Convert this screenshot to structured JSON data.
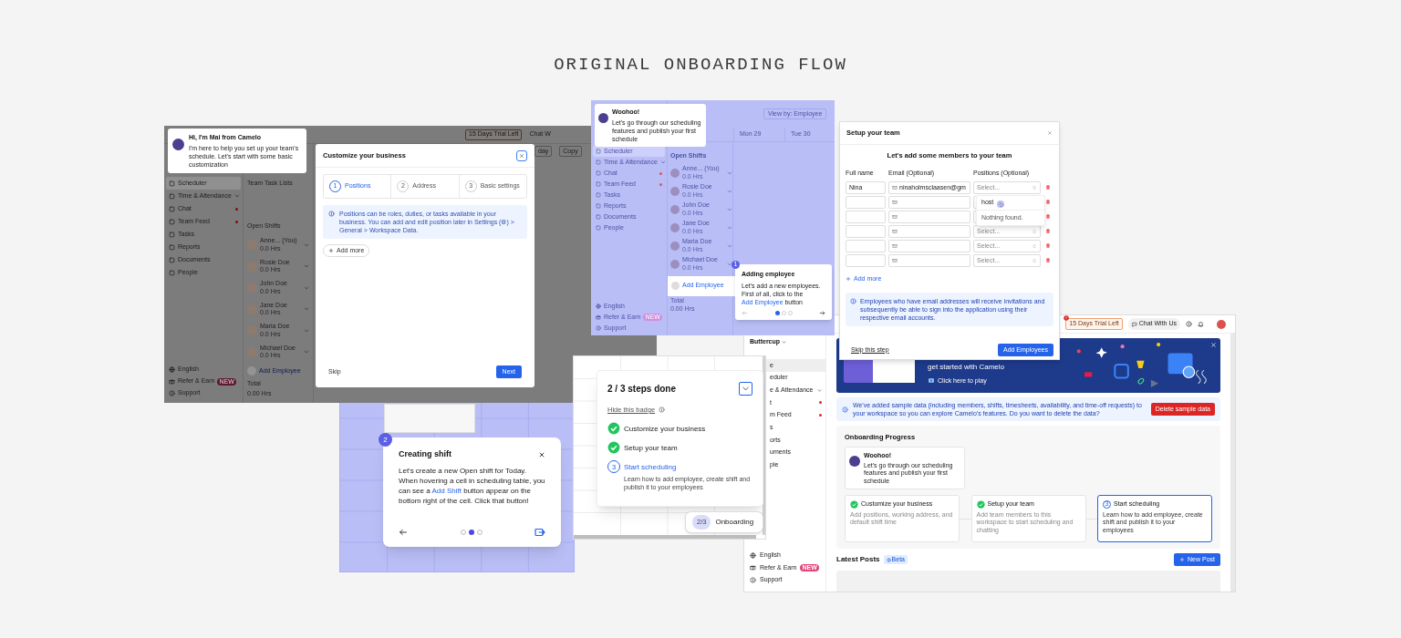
{
  "heading": "ORIGINAL ONBOARDING FLOW",
  "customize_screen": {
    "top_bar": {
      "trial": "15 Days Trial Left",
      "chat": "Chat W",
      "today_button": "day",
      "copy_button": "Copy"
    },
    "sidebar": {
      "items": [
        {
          "label": "Scheduler",
          "selected": true,
          "unread": false,
          "expandable": false
        },
        {
          "label": "Time & Attendance",
          "selected": false,
          "unread": false,
          "expandable": true
        },
        {
          "label": "Chat",
          "selected": false,
          "unread": true,
          "expandable": false
        },
        {
          "label": "Team Feed",
          "selected": false,
          "unread": true,
          "expandable": false
        },
        {
          "label": "Tasks",
          "selected": false,
          "unread": false,
          "expandable": false
        },
        {
          "label": "Reports",
          "selected": false,
          "unread": false,
          "expandable": false
        },
        {
          "label": "Documents",
          "selected": false,
          "unread": false,
          "expandable": false
        },
        {
          "label": "People",
          "selected": false,
          "unread": false,
          "expandable": false
        }
      ],
      "footer": [
        {
          "label": "English"
        },
        {
          "label": "Refer & Earn",
          "badge": "NEW"
        },
        {
          "label": "Support"
        }
      ]
    },
    "team_task_lists": "Team Task Lists",
    "open_shifts": "Open Shifts",
    "employees": [
      {
        "name": "Anne... (You)",
        "hours": "0.0 Hrs"
      },
      {
        "name": "Rosie Doe",
        "hours": "0.0 Hrs"
      },
      {
        "name": "John Doe",
        "hours": "0.0 Hrs"
      },
      {
        "name": "Jane Doe",
        "hours": "0.0 Hrs"
      },
      {
        "name": "Maria Doe",
        "hours": "0.0 Hrs"
      },
      {
        "name": "Michael Doe",
        "hours": "0.0 Hrs"
      }
    ],
    "add_employee": "Add Employee",
    "total": {
      "label": "Total",
      "hours": "0.00 Hrs"
    },
    "bubble": {
      "title": "Hi, I'm Mai from Camelo",
      "text": "I'm here to help you set up your team's schedule. Let's start with some basic customization"
    },
    "modal": {
      "title": "Customize your business",
      "steps": [
        {
          "number": "1",
          "label": "Positions",
          "selected": true
        },
        {
          "number": "2",
          "label": "Address",
          "selected": false
        },
        {
          "number": "3",
          "label": "Basic settings",
          "selected": false
        }
      ],
      "info": "Positions can be roles, duties, or tasks available in your business. You can add and edit position later in Settings (⚙) > General > Workspace Data.",
      "add_button": "Add more",
      "skip": "Skip",
      "next": "Next"
    }
  },
  "scheduler_screen": {
    "view_by": "View by: Employee",
    "day_columns": [
      "Mon 29",
      "Tue 30"
    ],
    "sidebar": {
      "items": [
        {
          "label": "Scheduler",
          "selected": true,
          "unread": false,
          "expandable": false
        },
        {
          "label": "Time & Attendance",
          "selected": false,
          "unread": false,
          "expandable": true
        },
        {
          "label": "Chat",
          "selected": false,
          "unread": true,
          "expandable": false
        },
        {
          "label": "Team Feed",
          "selected": false,
          "unread": true,
          "expandable": false
        },
        {
          "label": "Tasks",
          "selected": false,
          "unread": false,
          "expandable": false
        },
        {
          "label": "Reports",
          "selected": false,
          "unread": false,
          "expandable": false
        },
        {
          "label": "Documents",
          "selected": false,
          "unread": false,
          "expandable": false
        },
        {
          "label": "People",
          "selected": false,
          "unread": false,
          "expandable": false
        }
      ],
      "footer": [
        {
          "label": "English"
        },
        {
          "label": "Refer & Earn",
          "badge": "NEW"
        },
        {
          "label": "Support"
        }
      ]
    },
    "open_shifts": "Open Shifts",
    "employees": [
      {
        "name": "Anne... (You)",
        "hours": "0.0 Hrs"
      },
      {
        "name": "Rosie Doe",
        "hours": "0.0 Hrs"
      },
      {
        "name": "John Doe",
        "hours": "0.0 Hrs"
      },
      {
        "name": "Jane Doe",
        "hours": "0.0 Hrs"
      },
      {
        "name": "Maria Doe",
        "hours": "0.0 Hrs"
      },
      {
        "name": "Michael Doe",
        "hours": "0.0 Hrs"
      }
    ],
    "add_employee": "Add Employee",
    "total": {
      "label": "Total",
      "hours": "0.00 Hrs"
    },
    "bubble": {
      "title": "Woohoo!",
      "text": "Let's go through our scheduling features and publish your first schedule"
    },
    "tour": {
      "step": "1",
      "title": "Adding employee",
      "text_before": "Let's add a new employees. First of all, click to the ",
      "highlight": "Add Employee",
      "text_after": " button",
      "dots": [
        {
          "selected": true
        },
        {
          "selected": false
        },
        {
          "selected": false
        }
      ]
    }
  },
  "setup_team_modal": {
    "title": "Setup your team",
    "subtitle": "Let's add some members to your team",
    "columns": [
      "Full name",
      "Email (Optional)",
      "Positions (Optional)"
    ],
    "rows": [
      {
        "name": "Nina",
        "email": "ninaholmsclaasen@gm",
        "position_placeholder": "Select..."
      },
      {},
      {},
      {
        "position_placeholder": "Select..."
      },
      {
        "position_placeholder": "Select..."
      },
      {
        "position_placeholder": "Select..."
      }
    ],
    "dropdown": {
      "option": "host",
      "empty_text": "Nothing found."
    },
    "add_more": "Add more",
    "info": "Employees who have email addresses will receive invitations and subsequently be able to sign into the application using their respective email accounts.",
    "skip": "Skip this step",
    "submit": "Add Employees"
  },
  "home_screen": {
    "top_bar": {
      "trial": "15 Days Trial Left",
      "chat": "Chat With Us"
    },
    "workspace": "Buttercup",
    "sidebar": {
      "items": [
        {
          "label": "e",
          "selected": true,
          "unread": false,
          "expandable": false
        },
        {
          "label": "eduler",
          "selected": false,
          "unread": false,
          "expandable": false
        },
        {
          "label": "e & Attendance",
          "selected": false,
          "unread": false,
          "expandable": true
        },
        {
          "label": "t",
          "selected": false,
          "unread": true,
          "expandable": false
        },
        {
          "label": "m Feed",
          "selected": false,
          "unread": true,
          "expandable": false
        },
        {
          "label": "s",
          "selected": false,
          "unread": false,
          "expandable": false
        },
        {
          "label": "orts",
          "selected": false,
          "unread": false,
          "expandable": false
        },
        {
          "label": "uments",
          "selected": false,
          "unread": false,
          "expandable": false
        },
        {
          "label": "ple",
          "selected": false,
          "unread": false,
          "expandable": false
        }
      ],
      "footer": [
        {
          "label": "English"
        },
        {
          "label": "Refer & Earn",
          "badge": "NEW"
        },
        {
          "label": "Support"
        }
      ]
    },
    "banner": {
      "headline": "get started with Camelo",
      "play": "Click here to play"
    },
    "sample_notice": {
      "text": "We've added sample data (including members, shifts, timesheets, availability, and time-off requests) to your workspace so you can explore Camelo's features. Do you want to delete the data?",
      "button": "Delete sample data"
    },
    "onboarding": {
      "title": "Onboarding Progress",
      "bubble": {
        "title": "Woohoo!",
        "text": "Let's go through our scheduling features and publish your first schedule"
      },
      "steps": [
        {
          "label": "Customize your business",
          "description": "Add positions, working address, and default shift time",
          "done": true,
          "selected": false
        },
        {
          "label": "Setup your team",
          "description": "Add team members to this workspace to start scheduling and chatting",
          "done": true,
          "selected": false
        },
        {
          "number": "3",
          "label": "Start scheduling",
          "description": "Learn how to add employee, create shift and publish it to your employees",
          "done": false,
          "selected": true
        }
      ]
    },
    "latest_posts": {
      "title": "Latest Posts",
      "badge": "Beta",
      "button": "New Post"
    }
  },
  "shift_tour": {
    "step": "2",
    "title": "Creating shift",
    "text_before": "Let's create a new Open shift for Today. When hovering a cell in scheduling table, you can see a ",
    "highlight": "Add Shift",
    "text_after": " button appear on the bottom right of the cell. Click that button!",
    "dots": [
      {
        "selected": false
      },
      {
        "selected": true
      },
      {
        "selected": false
      }
    ]
  },
  "progress_badge": {
    "title": "2 / 3 steps done",
    "hide_link": "Hide this badge",
    "steps": [
      {
        "label": "Customize your business",
        "done": true
      },
      {
        "label": "Setup your team",
        "done": true
      },
      {
        "number": "3",
        "label": "Start scheduling",
        "done": false,
        "description": "Learn how to add employee, create shift and publish it to your employees"
      }
    ],
    "pill": {
      "count": "2/3",
      "label": "Onboarding"
    }
  }
}
